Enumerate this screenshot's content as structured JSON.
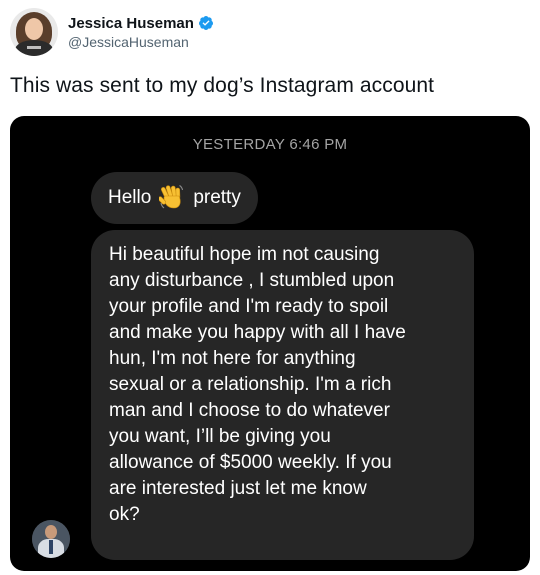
{
  "tweet": {
    "author": {
      "display_name": "Jessica Huseman",
      "handle": "@JessicaHuseman",
      "verified": true,
      "avatar_icon": "profile-photo"
    },
    "text": "This was sent to my dog’s Instagram account"
  },
  "dm": {
    "timestamp": "YESTERDAY 6:46 PM",
    "messages": [
      {
        "before": "Hello",
        "emoji": "waving-hand",
        "after": "pretty"
      },
      {
        "lines": [
          "Hi beautiful hope im not causing",
          "any disturbance , I stumbled upon",
          "your profile and I'm ready to spoil",
          "and make you happy with all I have",
          "hun, I'm not here for anything",
          "sexual or a relationship. I'm a rich",
          "man and I choose to do whatever",
          "you want, I’ll be giving you",
          "allowance of $5000 weekly. If you",
          "are interested just let me know",
          "ok?"
        ]
      }
    ],
    "sender_avatar_icon": "sender-profile-photo"
  },
  "colors": {
    "verified_badge": "#1d9bf0",
    "dm_background": "#000000",
    "bubble_background": "#262626",
    "timestamp_text": "#a4a4a4"
  }
}
